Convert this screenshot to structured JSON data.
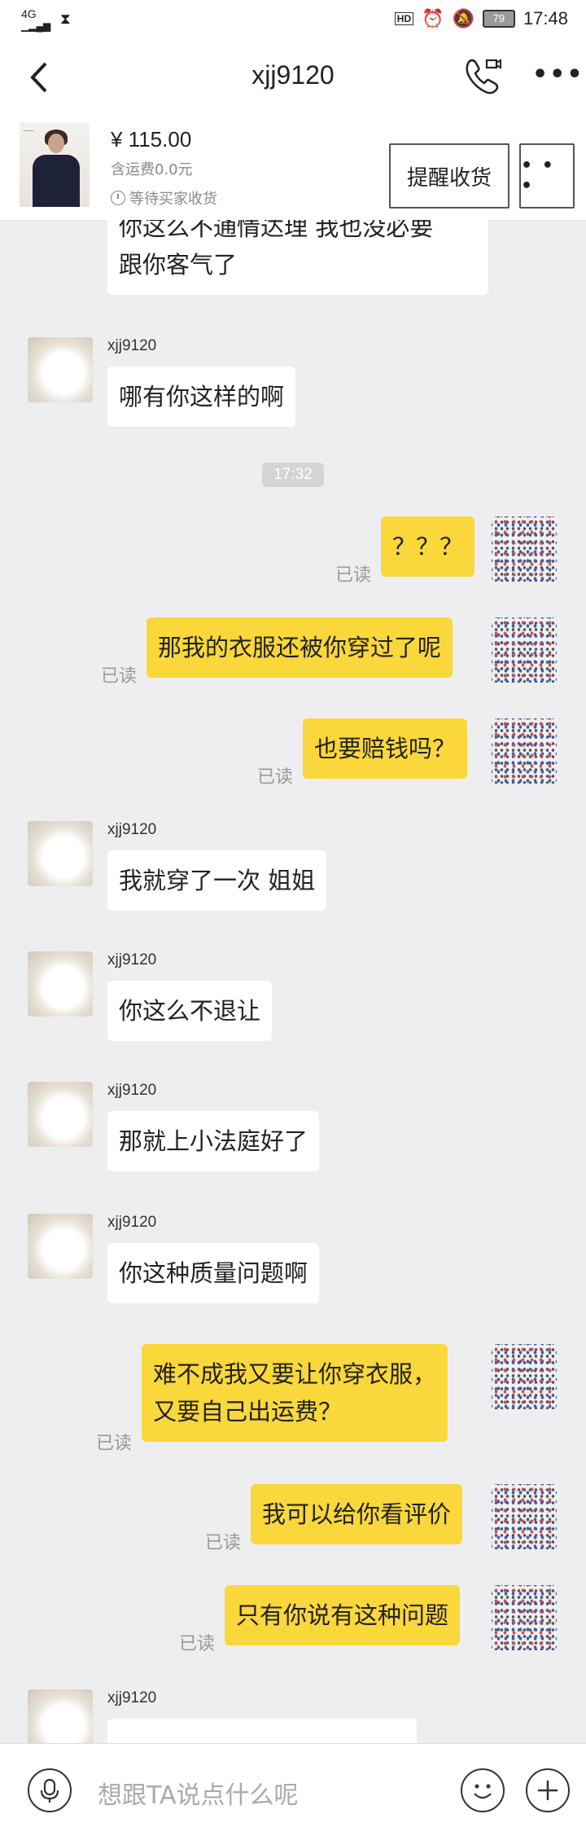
{
  "status_bar": {
    "network": "4G",
    "signal": "46 .ıll",
    "hd": "HD",
    "battery": "79",
    "time": "17:48"
  },
  "header": {
    "title": "xjj9120"
  },
  "order": {
    "price": "¥ 115.00",
    "shipping": "含运费0.0元",
    "status": "等待买家收货",
    "remind_button": "提醒收货",
    "more_button": "• • •"
  },
  "chat": {
    "timestamp": "17:32",
    "partial_incoming": "你这么不通情达理 我也没必要\n跟你客气了",
    "messages": [
      {
        "from": "them",
        "user": "xjj9120",
        "text": "哪有你这样的啊"
      },
      {
        "from": "me",
        "status": "已读",
        "text": "？？？"
      },
      {
        "from": "me",
        "status": "已读",
        "text": "那我的衣服还被你穿过了呢"
      },
      {
        "from": "me",
        "status": "已读",
        "text": "也要赔钱吗？"
      },
      {
        "from": "them",
        "user": "xjj9120",
        "text": "我就穿了一次 姐姐"
      },
      {
        "from": "them",
        "user": "xjj9120",
        "text": "你这么不退让"
      },
      {
        "from": "them",
        "user": "xjj9120",
        "text": "那就上小法庭好了"
      },
      {
        "from": "them",
        "user": "xjj9120",
        "text": "你这种质量问题啊"
      },
      {
        "from": "me",
        "status": "已读",
        "text": "难不成我又要让你穿衣服，\n又要自己出运费？"
      },
      {
        "from": "me",
        "status": "已读",
        "text": "我可以给你看评价"
      },
      {
        "from": "me",
        "status": "已读",
        "text": "只有你说有这种问题"
      },
      {
        "from": "them",
        "user": "xjj9120",
        "text": ""
      }
    ]
  },
  "input": {
    "placeholder": "想跟TA说点什么呢"
  }
}
